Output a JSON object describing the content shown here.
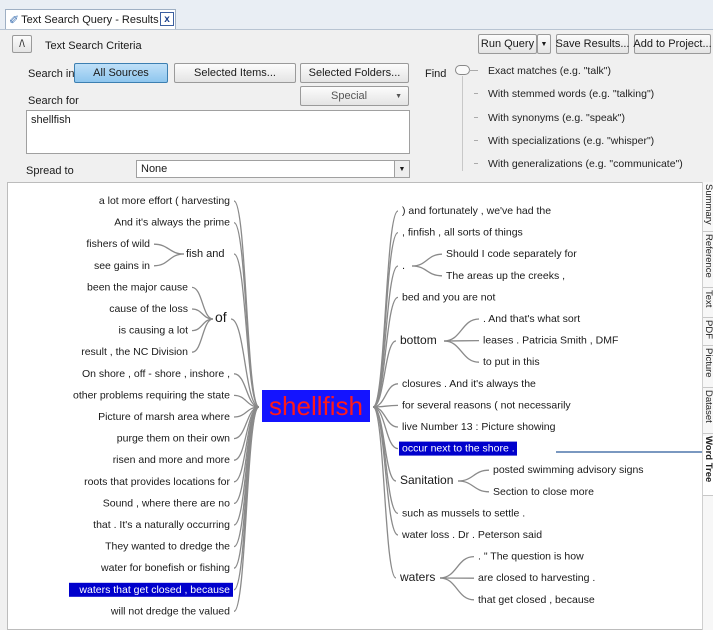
{
  "tab": {
    "title": "Text Search Query - Results Pr",
    "close": "x"
  },
  "criteria": {
    "collapse_glyph": "/\\",
    "title": "Text Search Criteria"
  },
  "toolbar": {
    "run_query": "Run Query",
    "save_results": "Save Results...",
    "add_to_project": "Add to Project..."
  },
  "search_in": {
    "label": "Search in",
    "all_sources": "All Sources",
    "selected_items": "Selected Items...",
    "selected_folders": "Selected Folders..."
  },
  "search_for": {
    "label": "Search for",
    "value": "shellfish",
    "special": "Special"
  },
  "spread_to": {
    "label": "Spread to",
    "value": "None"
  },
  "find": {
    "label": "Find",
    "options": [
      "Exact matches (e.g. \"talk\")",
      "With stemmed words (e.g. \"talking\")",
      "With synonyms (e.g. \"speak\")",
      "With specializations (e.g. \"whisper\")",
      "With generalizations (e.g. \"communicate\")"
    ]
  },
  "side_tabs": [
    "Summary",
    "Reference",
    "Text",
    "PDF",
    "Picture",
    "Dataset",
    "Word Tree"
  ],
  "tree": {
    "root": "shellfish",
    "left": [
      "a lot more effort ( harvesting",
      "And it's always the prime",
      "fishers of wild",
      "see gains in",
      "been the major cause",
      "cause of the loss",
      "is causing a lot",
      "result , the NC Division",
      "On shore , off - shore , inshore ,",
      "other problems requiring the state",
      "Picture of marsh area where",
      "purge them on their own",
      "risen and more and more",
      "roots that provides locations for",
      "Sound , where there are no",
      "that . It's a naturally occurring",
      "They wanted to dredge the",
      "water for bonefish or fishing",
      "waters that get closed , because",
      "will not dredge the valued"
    ],
    "left_groups": [
      "fish and",
      "of"
    ],
    "right": [
      ") and fortunately , we've had the",
      ", finfish , all sorts of things",
      "Should I code separately for",
      "The areas up the creeks ,",
      "bed and you are not",
      ". And that's what sort",
      "leases . Patricia Smith , DMF",
      "to put in this",
      "closures . And it's always the",
      "for several reasons ( not necessarily",
      "live Number 13 : Picture showing",
      "occur next to the shore .",
      "posted swimming advisory signs",
      "Section to close more",
      "such as mussels to settle .",
      "water loss . Dr . Peterson said",
      ". \" The question is how",
      "are closed to harvesting .",
      "that get closed , because"
    ],
    "right_groups": [
      ".",
      "bottom",
      "Sanitation",
      "waters"
    ]
  },
  "colors": {
    "root": "#ff1a1a",
    "root_bg": "#1414ff",
    "highlight_bg": "#0000cc",
    "highlight_fg": "#ffffff",
    "branch": "#8a8a8a"
  }
}
